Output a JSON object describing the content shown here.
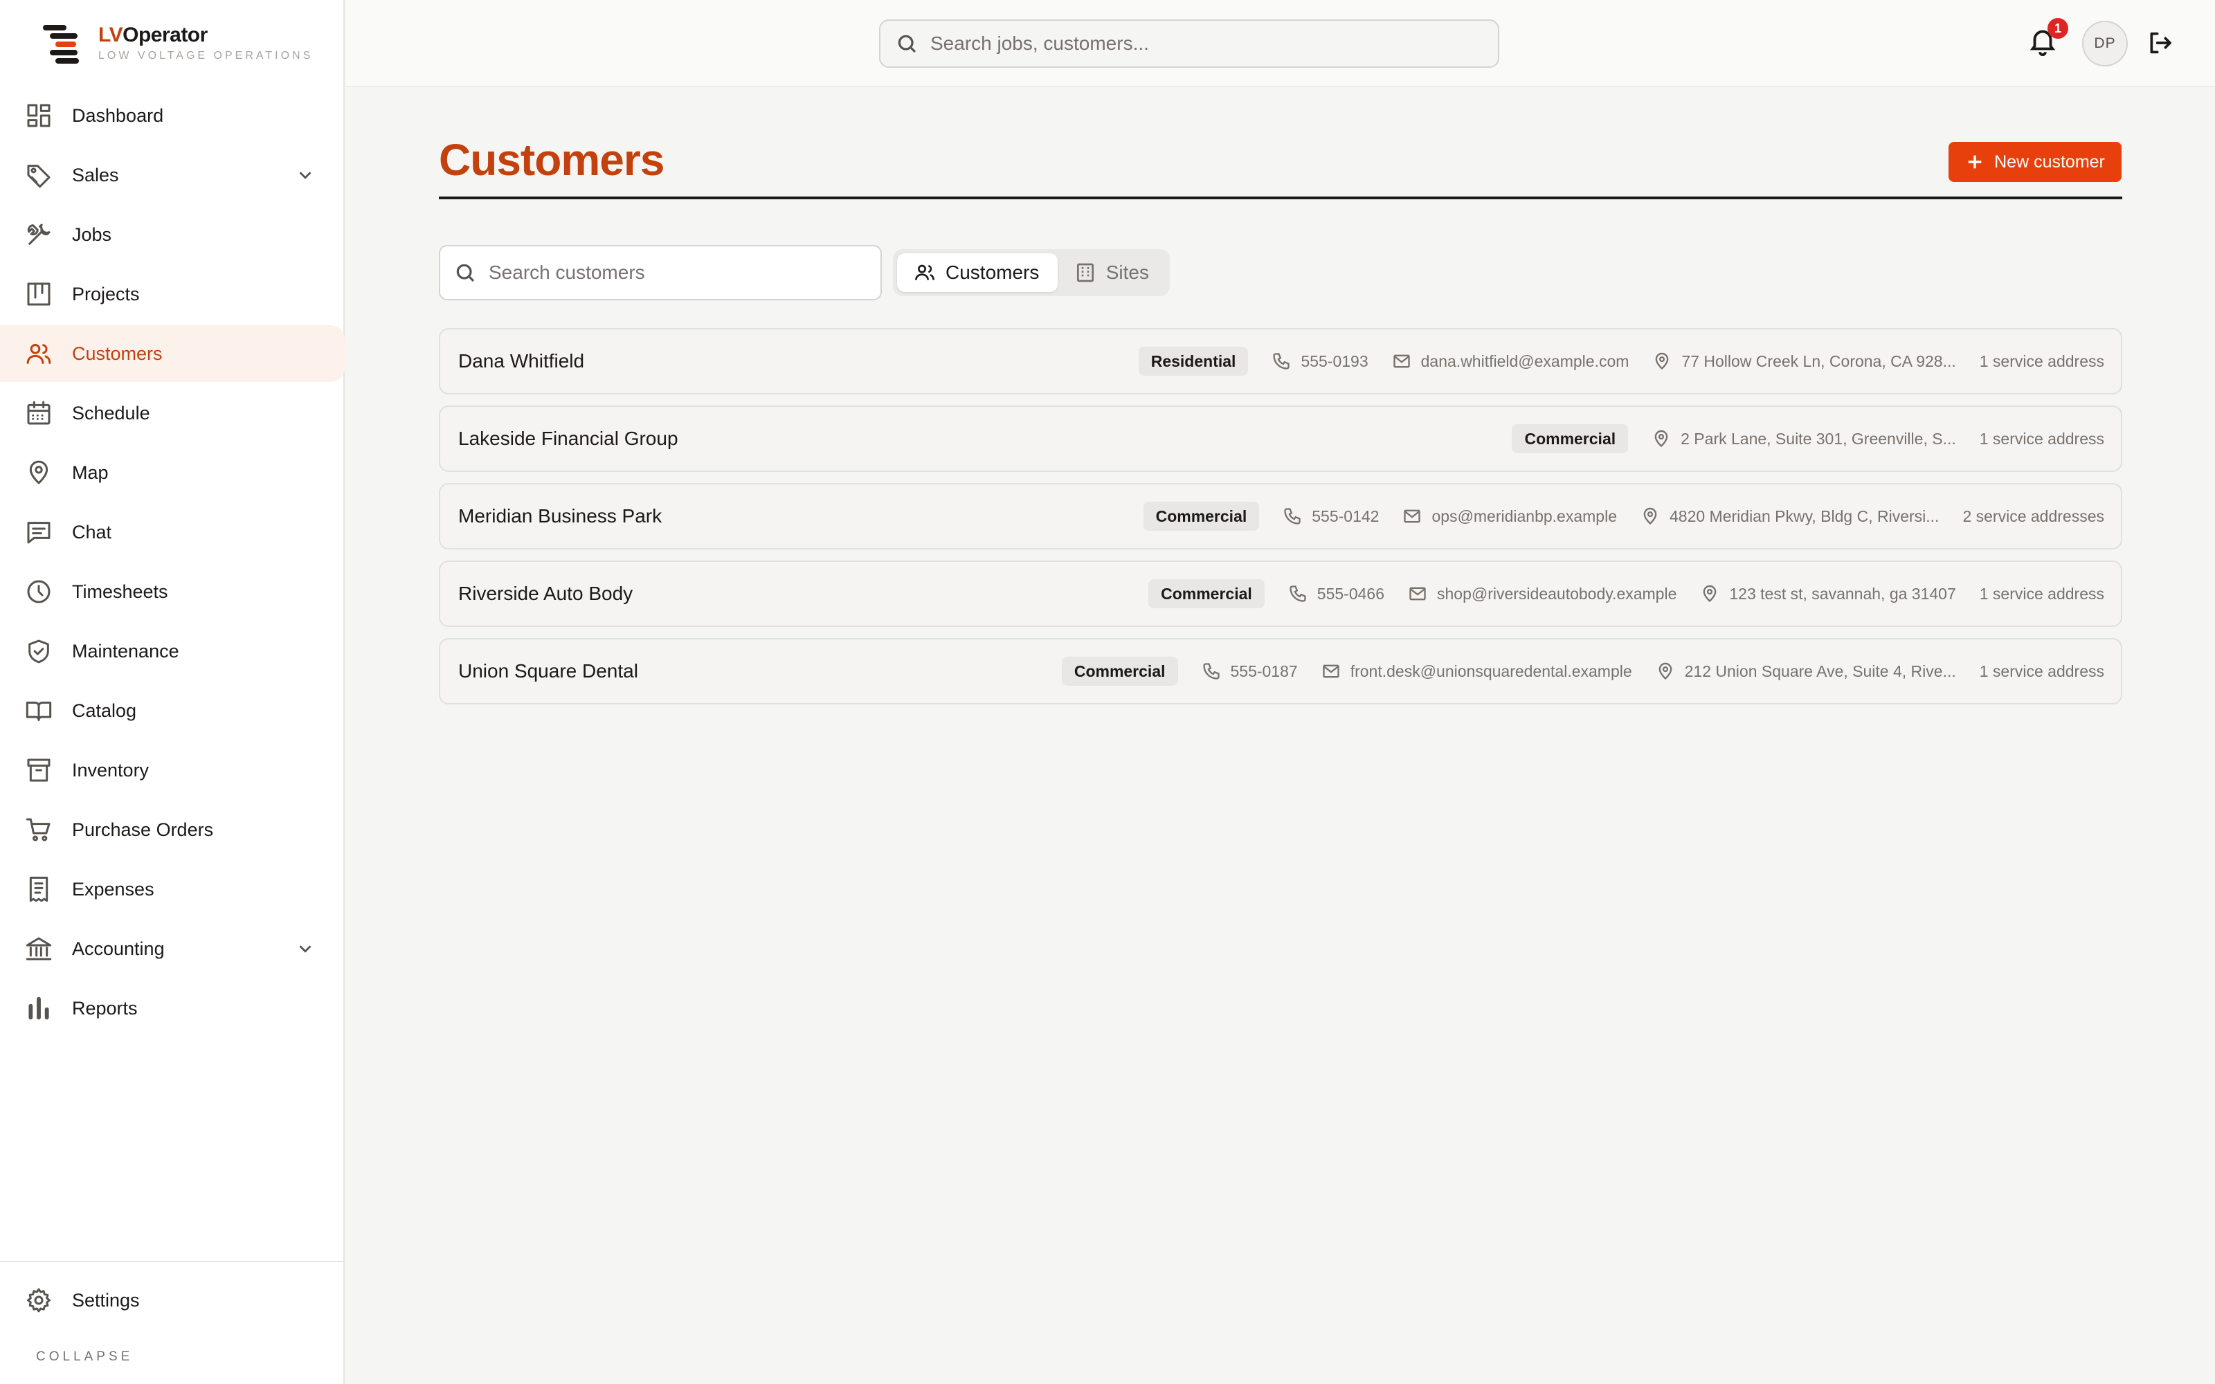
{
  "brand": {
    "name_prefix": "LV",
    "name_suffix": "Operator",
    "tagline": "LOW VOLTAGE OPERATIONS"
  },
  "colors": {
    "accent": "#c2410c",
    "button": "#e8400c",
    "badge_alert": "#dc2626"
  },
  "sidebar": {
    "items": [
      {
        "label": "Dashboard",
        "icon": "dashboard-icon"
      },
      {
        "label": "Sales",
        "icon": "tag-icon",
        "expandable": true
      },
      {
        "label": "Jobs",
        "icon": "wrench-icon"
      },
      {
        "label": "Projects",
        "icon": "kanban-icon"
      },
      {
        "label": "Customers",
        "icon": "users-icon",
        "active": true
      },
      {
        "label": "Schedule",
        "icon": "calendar-icon"
      },
      {
        "label": "Map",
        "icon": "map-pin-icon"
      },
      {
        "label": "Chat",
        "icon": "chat-icon"
      },
      {
        "label": "Timesheets",
        "icon": "clock-icon"
      },
      {
        "label": "Maintenance",
        "icon": "shield-check-icon"
      },
      {
        "label": "Catalog",
        "icon": "book-icon"
      },
      {
        "label": "Inventory",
        "icon": "archive-icon"
      },
      {
        "label": "Purchase Orders",
        "icon": "cart-icon"
      },
      {
        "label": "Expenses",
        "icon": "receipt-icon"
      },
      {
        "label": "Accounting",
        "icon": "bank-icon",
        "expandable": true
      },
      {
        "label": "Reports",
        "icon": "bar-chart-icon"
      }
    ],
    "settings_label": "Settings",
    "collapse_label": "COLLAPSE"
  },
  "topbar": {
    "search_placeholder": "Search jobs, customers...",
    "notification_count": "1",
    "avatar_initials": "DP"
  },
  "main": {
    "title": "Customers",
    "new_button_label": "New customer",
    "search_placeholder": "Search customers",
    "tabs": [
      {
        "label": "Customers",
        "icon": "users-icon",
        "active": true
      },
      {
        "label": "Sites",
        "icon": "building-icon",
        "active": false
      }
    ],
    "customers": [
      {
        "name": "Dana Whitfield",
        "type": "Residential",
        "phone": "555-0193",
        "email": "dana.whitfield@example.com",
        "address": "77 Hollow Creek Ln, Corona, CA 928...",
        "service": "1 service address"
      },
      {
        "name": "Lakeside Financial Group",
        "type": "Commercial",
        "phone": "",
        "email": "",
        "address": "2 Park Lane, Suite 301, Greenville, S...",
        "service": "1 service address"
      },
      {
        "name": "Meridian Business Park",
        "type": "Commercial",
        "phone": "555-0142",
        "email": "ops@meridianbp.example",
        "address": "4820 Meridian Pkwy, Bldg C, Riversi...",
        "service": "2 service addresses"
      },
      {
        "name": "Riverside Auto Body",
        "type": "Commercial",
        "phone": "555-0466",
        "email": "shop@riversideautobody.example",
        "address": "123 test st, savannah, ga 31407",
        "service": "1 service address"
      },
      {
        "name": "Union Square Dental",
        "type": "Commercial",
        "phone": "555-0187",
        "email": "front.desk@unionsquaredental.example",
        "address": "212 Union Square Ave, Suite 4, Rive...",
        "service": "1 service address"
      }
    ]
  }
}
